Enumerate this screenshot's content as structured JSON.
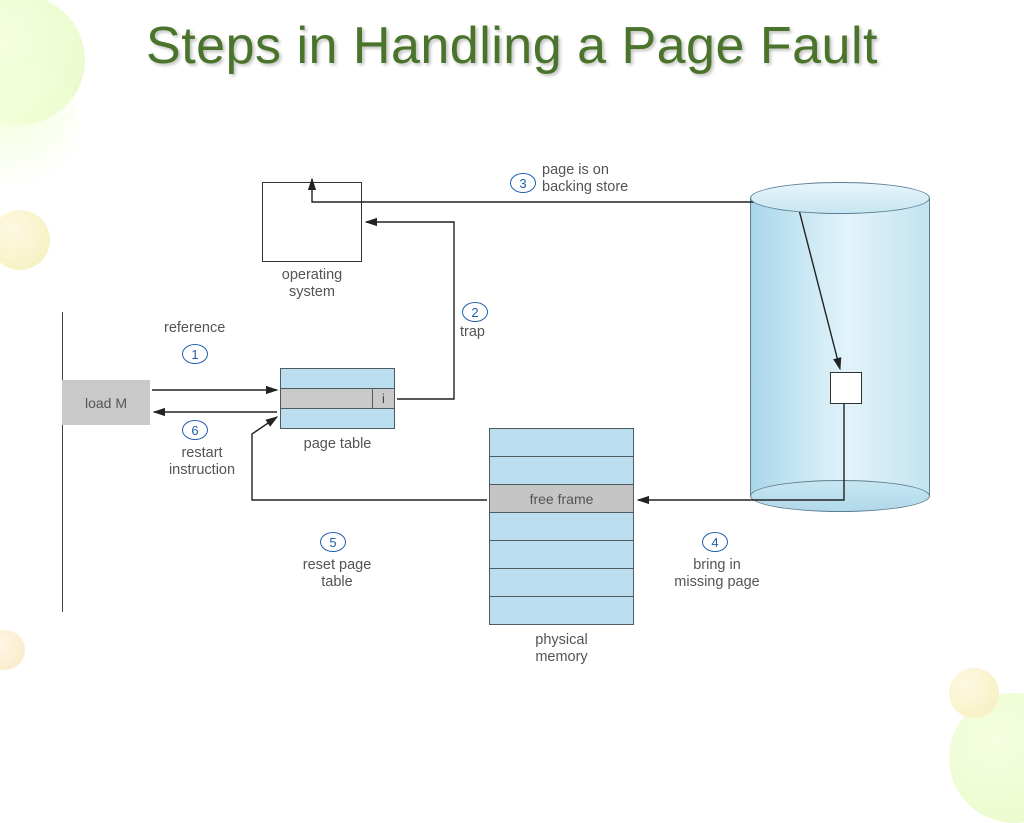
{
  "title": "Steps in Handling a Page Fault",
  "steps": {
    "s1": "1",
    "s2": "2",
    "s3": "3",
    "s4": "4",
    "s5": "5",
    "s6": "6"
  },
  "labels": {
    "reference": "reference",
    "trap": "trap",
    "page_on_backing_store_l1": "page is on",
    "page_on_backing_store_l2": "backing store",
    "bring_in_missing_l1": "bring in",
    "bring_in_missing_l2": "missing page",
    "reset_page_table_l1": "reset page",
    "reset_page_table_l2": "table",
    "restart_instruction_l1": "restart",
    "restart_instruction_l2": "instruction"
  },
  "components": {
    "operating_system": "operating\nsystem",
    "page_table": "page table",
    "physical_memory_l1": "physical",
    "physical_memory_l2": "memory",
    "load_m": "load M",
    "page_table_bit": "i",
    "free_frame": "free frame"
  }
}
